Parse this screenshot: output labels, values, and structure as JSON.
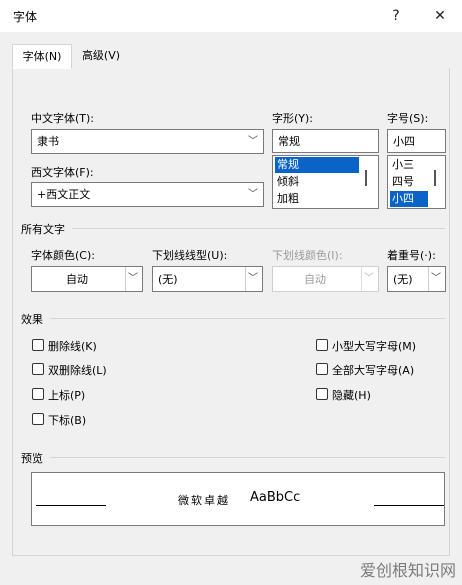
{
  "window": {
    "title": "字体",
    "help_label": "?",
    "close_label": "✕"
  },
  "tabs": [
    {
      "label": "字体(N)",
      "active": true
    },
    {
      "label": "高级(V)",
      "active": false
    }
  ],
  "chinese_font": {
    "label": "中文字体(T):",
    "value": "隶书"
  },
  "font_style": {
    "label": "字形(Y):",
    "value": "常规",
    "options": [
      "常规",
      "倾斜",
      "加粗"
    ],
    "selected": "常规"
  },
  "font_size": {
    "label": "字号(S):",
    "value": "小四",
    "options": [
      "小三",
      "四号",
      "小四"
    ],
    "selected": "小四"
  },
  "western_font": {
    "label": "西文字体(F):",
    "value": "+西文正文"
  },
  "all_text": {
    "section_label": "所有文字",
    "font_color": {
      "label": "字体颜色(C):",
      "value": "自动"
    },
    "underline_style": {
      "label": "下划线线型(U):",
      "value": "(无)"
    },
    "underline_color": {
      "label": "下划线颜色(I):",
      "value": "自动"
    },
    "emphasis": {
      "label": "着重号(·):",
      "value": "(无)"
    }
  },
  "effects": {
    "section_label": "效果",
    "strikethrough": "删除线(K)",
    "double_strikethrough": "双删除线(L)",
    "superscript": "上标(P)",
    "subscript": "下标(B)",
    "small_caps": "小型大写字母(M)",
    "all_caps": "全部大写字母(A)",
    "hidden": "隐藏(H)"
  },
  "preview": {
    "section_label": "预览",
    "sample_cn": "微软卓越",
    "sample_en": "AaBbCc"
  },
  "watermark": "爱创根知识网",
  "icons": {
    "dropdown": "chevron-down-icon",
    "close": "close-icon",
    "help": "help-icon"
  },
  "colors": {
    "selection": "#0a64c8",
    "disabled_text": "#9a9a9a"
  }
}
